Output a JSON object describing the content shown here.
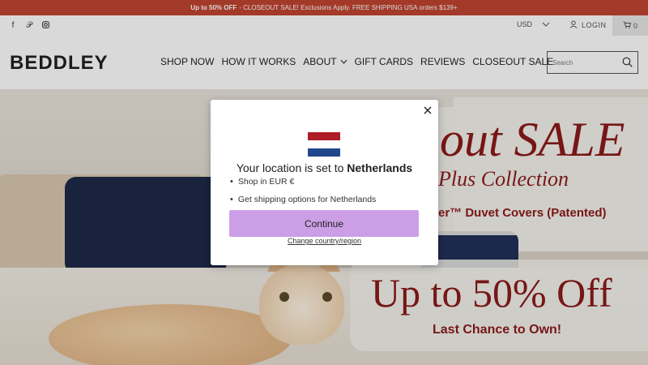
{
  "promo": {
    "bold": "Up to 50% OFF",
    "text": "- CLOSEOUT SALE! Exclusions Apply. FREE SHIPPING USA orders $139+"
  },
  "utility": {
    "currency": "USD",
    "login": "LOGIN",
    "cart_count": "0",
    "social_icons": [
      "facebook-icon",
      "pinterest-icon",
      "instagram-icon"
    ]
  },
  "header": {
    "logo": "BEDDLEY",
    "nav": [
      "SHOP NOW",
      "HOW IT WORKS",
      "ABOUT",
      "GIFT CARDS",
      "REVIEWS",
      "CLOSEOUT SALE"
    ],
    "search_placeholder": "Search"
  },
  "hero": {
    "sale_title": "out SALE",
    "collection": "Plus Collection",
    "duvet": "er™ Duvet Covers  (Patented)",
    "discount": "Up to 50% Off",
    "last_chance": "Last Chance to Own!"
  },
  "modal": {
    "title_prefix": "Your location is set to",
    "country": "Netherlands",
    "bullets": [
      "Shop in EUR €",
      "Get shipping options for Netherlands"
    ],
    "continue_label": "Continue",
    "change_label": "Change country/region",
    "flag_colors": [
      "#ae1c28",
      "#ffffff",
      "#21468b"
    ]
  },
  "colors": {
    "promo_bg": "#c0432f",
    "accent": "#cc9ee6",
    "hero_text": "#8b1a1a"
  }
}
